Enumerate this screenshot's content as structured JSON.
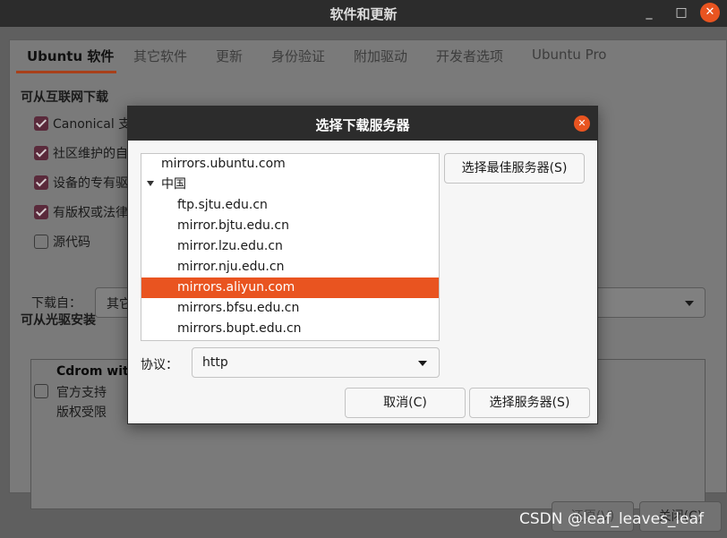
{
  "window": {
    "title": "软件和更新",
    "min_symbol": "_",
    "max_symbol": "□",
    "close_symbol": "✕"
  },
  "tabs": [
    {
      "label": "Ubuntu 软件"
    },
    {
      "label": "其它软件"
    },
    {
      "label": "更新"
    },
    {
      "label": "身份验证"
    },
    {
      "label": "附加驱动"
    },
    {
      "label": "开发者选项"
    },
    {
      "label": "Ubuntu Pro"
    }
  ],
  "internet": {
    "heading": "可从互联网下载",
    "options": [
      {
        "label": "Canonical 支",
        "checked": true
      },
      {
        "label": "社区维护的自",
        "checked": true
      },
      {
        "label": "设备的专有驱",
        "checked": true
      },
      {
        "label": "有版权或法律",
        "checked": true
      },
      {
        "label": "源代码",
        "checked": false
      }
    ],
    "download_from_label": "下载自：",
    "download_from_value": "其它"
  },
  "cdrom": {
    "heading": "可从光驱安装",
    "name": "Cdrom with",
    "line1": "官方支持",
    "line2": "版权受限"
  },
  "bottom": {
    "revert_label": "还原(V)",
    "close_label": "关闭(C)"
  },
  "watermark": "CSDN @leaf_leaves_leaf",
  "dialog": {
    "title": "选择下载服务器",
    "close_symbol": "✕",
    "servers": [
      {
        "label": "mirrors.ubuntu.com",
        "level": 0,
        "expandable": false,
        "selected": false
      },
      {
        "label": "中国",
        "level": 0,
        "expandable": true,
        "selected": false
      },
      {
        "label": "ftp.sjtu.edu.cn",
        "level": 1,
        "expandable": false,
        "selected": false
      },
      {
        "label": "mirror.bjtu.edu.cn",
        "level": 1,
        "expandable": false,
        "selected": false
      },
      {
        "label": "mirror.lzu.edu.cn",
        "level": 1,
        "expandable": false,
        "selected": false
      },
      {
        "label": "mirror.nju.edu.cn",
        "level": 1,
        "expandable": false,
        "selected": false
      },
      {
        "label": "mirrors.aliyun.com",
        "level": 1,
        "expandable": false,
        "selected": true
      },
      {
        "label": "mirrors.bfsu.edu.cn",
        "level": 1,
        "expandable": false,
        "selected": false
      },
      {
        "label": "mirrors.bupt.edu.cn",
        "level": 1,
        "expandable": false,
        "selected": false
      }
    ],
    "best_server_label": "选择最佳服务器(S)",
    "protocol_label": "协议：",
    "protocol_value": "http",
    "cancel_label": "取消(C)",
    "choose_label": "选择服务器(S)"
  },
  "colors": {
    "accent": "#e95420",
    "checkbox": "#5a2a3b",
    "titlebar": "#2c2c2c"
  }
}
